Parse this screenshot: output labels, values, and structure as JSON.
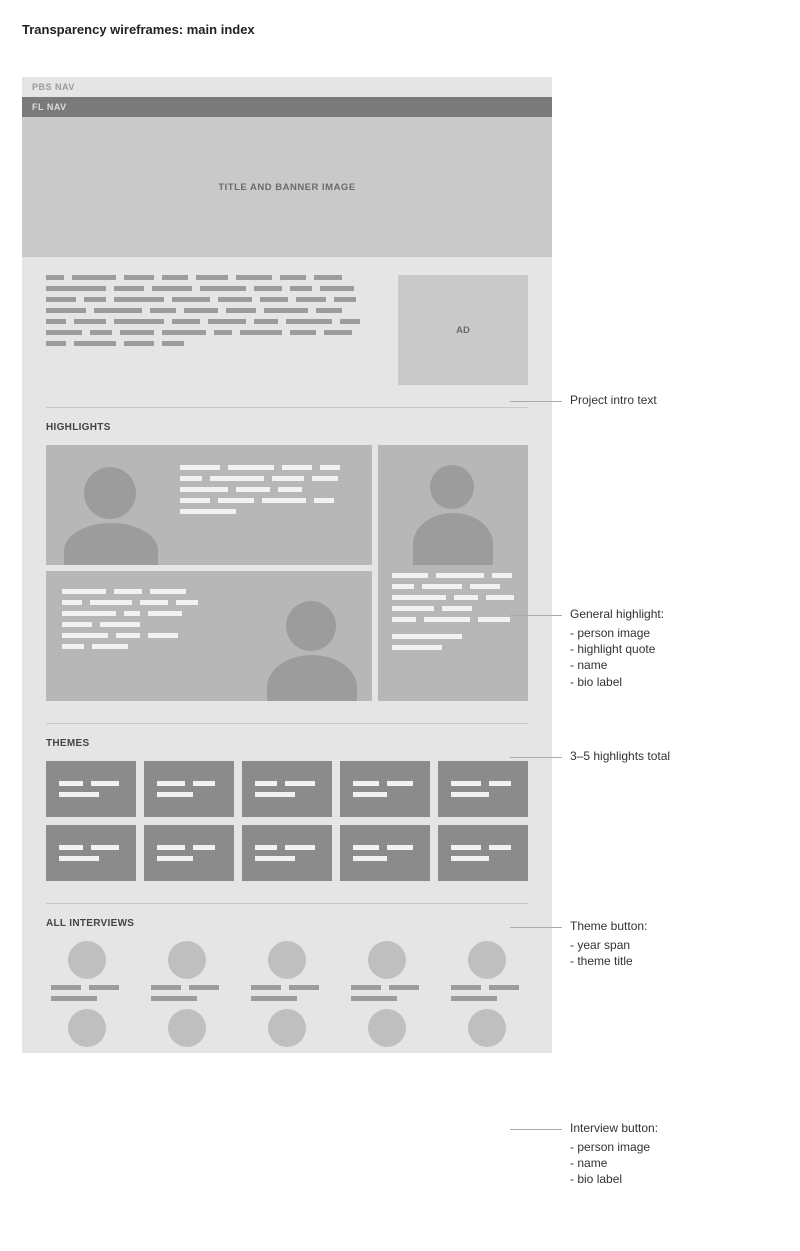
{
  "page_title": "Transparency wireframes: main index",
  "nav": {
    "pbs": "PBS NAV",
    "fl": "FL NAV"
  },
  "banner": "TITLE AND BANNER IMAGE",
  "ad": "AD",
  "sections": {
    "highlights": "HIGHLIGHTS",
    "themes": "THEMES",
    "interviews": "ALL INTERVIEWS"
  },
  "annotations": {
    "intro": "Project intro text",
    "highlight": {
      "title": "General highlight:",
      "items": [
        "person image",
        "highlight quote",
        "name",
        "bio label"
      ]
    },
    "highlight_count": "3–5 highlights total",
    "theme": {
      "title": "Theme button:",
      "items": [
        "year span",
        "theme title"
      ]
    },
    "interview": {
      "title": "Interview button:",
      "items": [
        "person image",
        "name",
        "bio label"
      ]
    }
  }
}
